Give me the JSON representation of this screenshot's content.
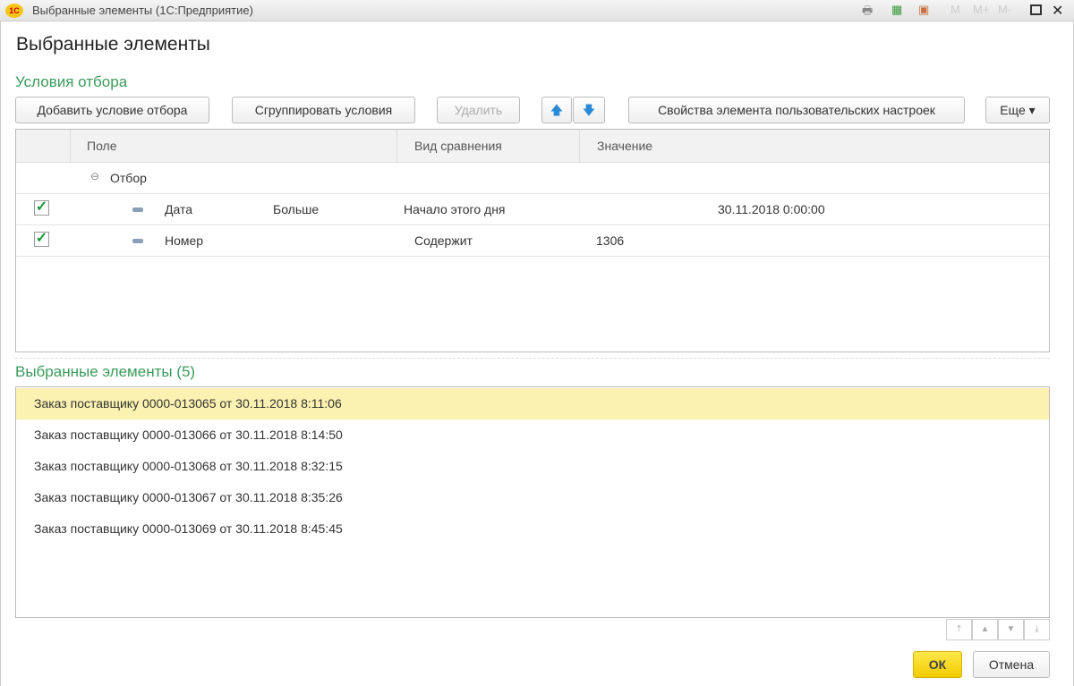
{
  "window": {
    "title": "Выбранные элементы  (1С:Предприятие)",
    "logo": "1С",
    "m": "M",
    "mplus": "M+",
    "mminus": "M-",
    "close": "✕"
  },
  "page_title": "Выбранные элементы",
  "filter": {
    "section_title": "Условия отбора",
    "buttons": {
      "add": "Добавить условие отбора",
      "group": "Сгруппировать условия",
      "delete": "Удалить",
      "up": "🡅",
      "down": "🡇",
      "properties": "Свойства элемента пользовательских настроек",
      "more": "Еще ▾"
    },
    "columns": [
      "Поле",
      "Вид сравнения",
      "Значение"
    ],
    "group_label": "Отбор",
    "rows": [
      {
        "field": "Дата",
        "comparison": "Больше",
        "value": "Начало этого дня",
        "extra": "30.11.2018 0:00:00",
        "checked": true
      },
      {
        "field": "Номер",
        "comparison": "Содержит",
        "value": "1306",
        "checked": true
      }
    ]
  },
  "selected": {
    "section_title": "Выбранные элементы (5)",
    "items": [
      "Заказ поставщику 0000-013065 от 30.11.2018 8:11:06",
      "Заказ поставщику 0000-013066 от 30.11.2018 8:14:50",
      "Заказ поставщику 0000-013068 от 30.11.2018 8:32:15",
      "Заказ поставщику 0000-013067 от 30.11.2018 8:35:26",
      "Заказ поставщику 0000-013069 от 30.11.2018 8:45:45"
    ]
  },
  "footer": {
    "ok": "ОК",
    "cancel": "Отмена"
  }
}
